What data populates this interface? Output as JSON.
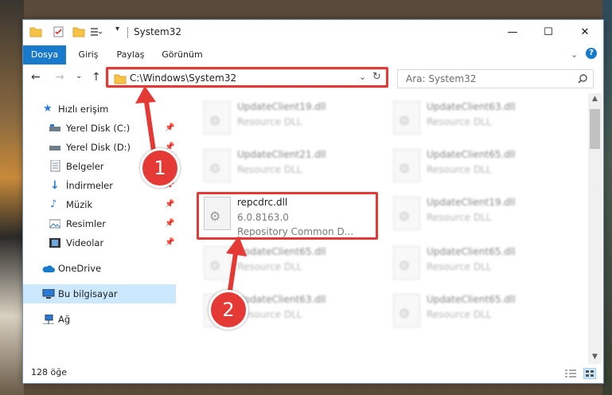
{
  "window": {
    "title": "System32",
    "min_symbol": "—",
    "max_symbol": "☐",
    "close_symbol": "✕"
  },
  "ribbon": {
    "tabs": [
      "Dosya",
      "Giriş",
      "Paylaş",
      "Görünüm"
    ],
    "active_tab": "Dosya",
    "accent": "#1979ca"
  },
  "nav": {
    "back": "←",
    "forward": "→",
    "recent": "⌄",
    "up": "↑",
    "address": "C:\\Windows\\System32",
    "search_placeholder": "Ara: System32"
  },
  "sidebar": {
    "items": [
      {
        "label": "Hızlı erişim",
        "icon": "star-icon",
        "pinned": false
      },
      {
        "label": "Yerel Disk (C:)",
        "icon": "drive-icon",
        "pinned": true
      },
      {
        "label": "Yerel Disk (D:)",
        "icon": "drive-icon",
        "pinned": true
      },
      {
        "label": "Belgeler",
        "icon": "document-icon",
        "pinned": true
      },
      {
        "label": "İndirmeler",
        "icon": "download-icon",
        "pinned": true
      },
      {
        "label": "Müzik",
        "icon": "music-icon",
        "pinned": true
      },
      {
        "label": "Resimler",
        "icon": "pictures-icon",
        "pinned": true
      },
      {
        "label": "Videolar",
        "icon": "video-icon",
        "pinned": true
      },
      {
        "label": "OneDrive",
        "icon": "cloud-icon",
        "pinned": false
      },
      {
        "label": "Bu bilgisayar",
        "icon": "computer-icon",
        "pinned": false
      },
      {
        "label": "Ağ",
        "icon": "network-icon",
        "pinned": false
      }
    ]
  },
  "files": [
    {
      "name": "UpdateClient19.dll",
      "desc": "Resource DLL"
    },
    {
      "name": "UpdateClient63.dll",
      "desc": "Resource DLL"
    },
    {
      "name": "UpdateClient21.dll",
      "desc": "Resource DLL"
    },
    {
      "name": "UpdateClient65.dll",
      "desc": "Resource DLL"
    },
    {
      "name": "repcdrc.dll",
      "version": "6.0.8163.0",
      "desc": "Repository Common D..."
    },
    {
      "name": "UpdateClient19.dll",
      "desc": "Resource DLL"
    },
    {
      "name": "UpdateClient65.dll",
      "desc": "Resource DLL"
    },
    {
      "name": "UpdateClient65.dll",
      "desc": "Resource DLL"
    },
    {
      "name": "UpdateClient63.dll",
      "desc": "Resource DLL"
    },
    {
      "name": "UpdateClient65.dll",
      "desc": "Resource DLL"
    }
  ],
  "status": {
    "count": "128 öğe"
  },
  "annotations": {
    "badge1": "1",
    "badge2": "2",
    "color": "#e53935"
  }
}
